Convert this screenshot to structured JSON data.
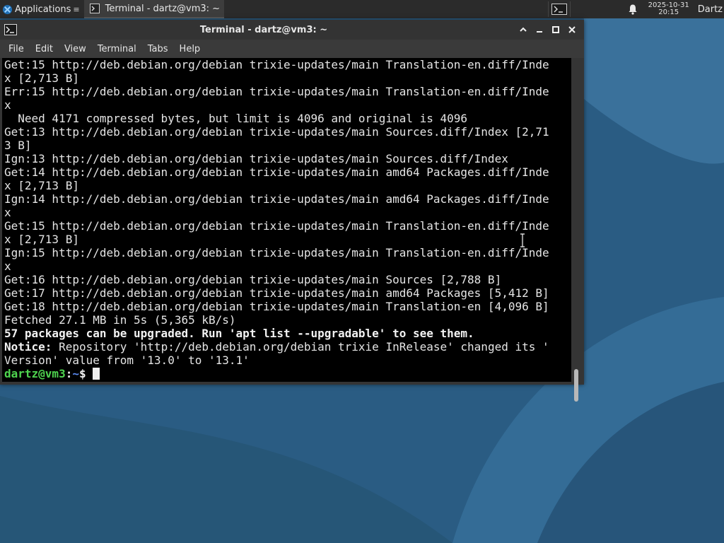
{
  "panel": {
    "applications_label": "Applications",
    "applications_arrow": "≡",
    "task_label": "Terminal - dartz@vm3: ~",
    "clock_date": "2025-10-31",
    "clock_time": "20:15",
    "user_label": "Dartz",
    "icons": [
      "xfce-logo-icon",
      "terminal-icon",
      "workspace-icon",
      "bell-icon"
    ]
  },
  "window": {
    "title": "Terminal - dartz@vm3: ~",
    "controls": [
      "chevron-up-icon",
      "minimize-icon",
      "maximize-icon",
      "close-icon"
    ],
    "menu": [
      "File",
      "Edit",
      "View",
      "Terminal",
      "Tabs",
      "Help"
    ]
  },
  "terminal": {
    "lines": [
      "Get:15 http://deb.debian.org/debian trixie-updates/main Translation-en.diff/Inde",
      "x [2,713 B]",
      "Err:15 http://deb.debian.org/debian trixie-updates/main Translation-en.diff/Inde",
      "x",
      "  Need 4171 compressed bytes, but limit is 4096 and original is 4096",
      "Get:13 http://deb.debian.org/debian trixie-updates/main Sources.diff/Index [2,71",
      "3 B]",
      "Ign:13 http://deb.debian.org/debian trixie-updates/main Sources.diff/Index",
      "Get:14 http://deb.debian.org/debian trixie-updates/main amd64 Packages.diff/Inde",
      "x [2,713 B]",
      "Ign:14 http://deb.debian.org/debian trixie-updates/main amd64 Packages.diff/Inde",
      "x",
      "Get:15 http://deb.debian.org/debian trixie-updates/main Translation-en.diff/Inde",
      "x [2,713 B]",
      "Ign:15 http://deb.debian.org/debian trixie-updates/main Translation-en.diff/Inde",
      "x",
      "Get:16 http://deb.debian.org/debian trixie-updates/main Sources [2,788 B]",
      "Get:17 http://deb.debian.org/debian trixie-updates/main amd64 Packages [5,412 B]",
      "Get:18 http://deb.debian.org/debian trixie-updates/main Translation-en [4,096 B]",
      "Fetched 27.1 MB in 5s (5,365 kB/s)"
    ],
    "upgrade_line": "57 packages can be upgraded. Run 'apt list --upgradable' to see them.",
    "notice_label": "Notice:",
    "notice_text": " Repository 'http://deb.debian.org/debian trixie InRelease' changed its '",
    "notice_cont": "Version' value from '13.0' to '13.1'",
    "prompt_user": "dartz@vm3",
    "prompt_sep": ":",
    "prompt_path": "~",
    "prompt_symbol": "$ ",
    "scroll_position": 1.0
  },
  "colors": {
    "prompt_user": "#4fd44f",
    "prompt_path": "#5b8af0",
    "terminal_bg": "#000000",
    "desktop_bg": "#2b5f86"
  }
}
